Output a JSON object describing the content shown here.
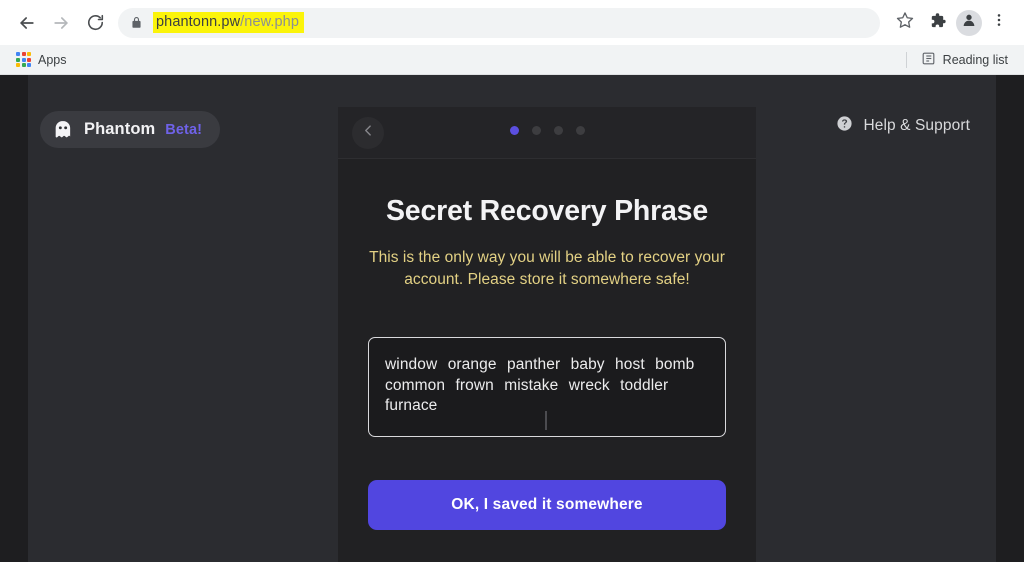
{
  "browser": {
    "back_icon": "arrow-left-icon",
    "forward_icon": "arrow-right-icon",
    "reload_icon": "reload-icon",
    "lock_icon": "lock-icon",
    "url": {
      "host": "phantonn.pw",
      "path": "/new.php",
      "highlight_color": "#fbf40a"
    },
    "bookmark_icon": "star-icon",
    "extensions_icon": "puzzle-icon",
    "profile_icon": "profile-avatar-icon",
    "menu_icon": "three-dot-menu-icon",
    "bookmarks_bar": {
      "apps_icon": "apps-grid-icon",
      "apps_label": "Apps",
      "reading_list_icon": "reading-list-icon",
      "reading_list_label": "Reading list"
    }
  },
  "page": {
    "background_color": "#2b2c30",
    "brand": {
      "icon": "ghost-icon",
      "name": "Phantom",
      "beta_label": "Beta!",
      "beta_color": "#6f62e8"
    },
    "help": {
      "icon": "question-mark-circle-icon",
      "label": "Help & Support"
    }
  },
  "modal": {
    "background_color": "#212123",
    "back_button_icon": "chevron-left-icon",
    "steps": {
      "total": 4,
      "active_index": 0,
      "active_color": "#5b4fe0",
      "inactive_color": "#3d3d40"
    },
    "title": "Secret Recovery Phrase",
    "warning": "This is the only way you will be able to recover your account. Please store it somewhere safe!",
    "warning_color": "#e3d184",
    "seed_phrase": {
      "words": [
        "window",
        "orange",
        "panther",
        "baby",
        "host",
        "bomb",
        "common",
        "frown",
        "mistake",
        "wreck",
        "toddler",
        "furnace"
      ],
      "text": "window orange panther baby host bomb common frown mistake wreck toddler furnace",
      "border_color": "#d9d9dc"
    },
    "cta": {
      "label": "OK, I saved it somewhere",
      "color": "#5146e0"
    }
  }
}
